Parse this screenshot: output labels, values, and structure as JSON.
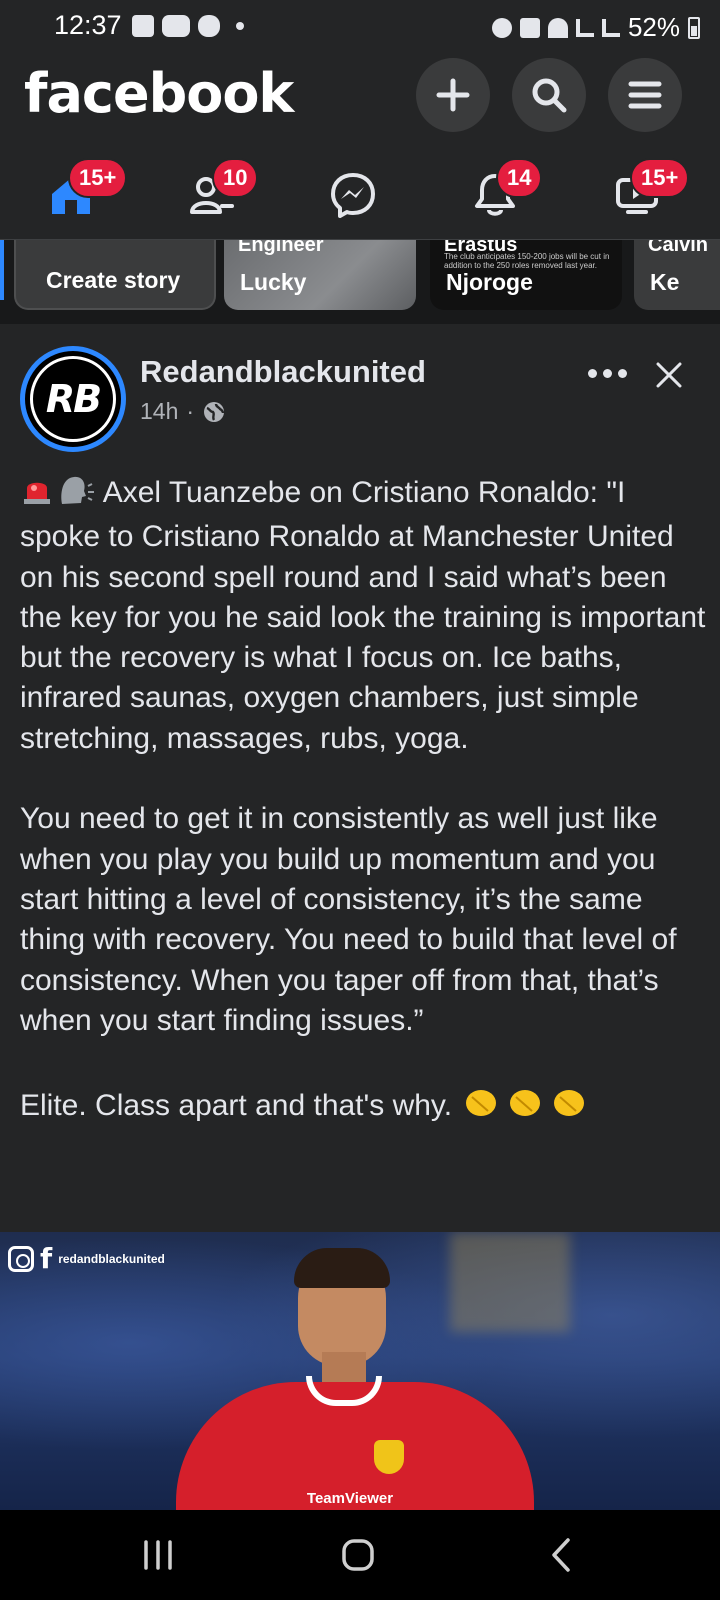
{
  "status_bar": {
    "time": "12:37",
    "battery": "52%"
  },
  "header": {
    "logo": "facebook",
    "buttons": [
      {
        "name": "create",
        "icon": "plus-icon"
      },
      {
        "name": "search",
        "icon": "search-icon"
      },
      {
        "name": "menu",
        "icon": "menu-icon"
      }
    ]
  },
  "nav_tabs": [
    {
      "name": "home",
      "icon": "home-icon",
      "badge": "15+"
    },
    {
      "name": "friends",
      "icon": "friends-icon",
      "badge": "10"
    },
    {
      "name": "messenger",
      "icon": "messenger-icon",
      "badge": ""
    },
    {
      "name": "notifications",
      "icon": "bell-icon",
      "badge": "14"
    },
    {
      "name": "video",
      "icon": "video-icon",
      "badge": "15+"
    }
  ],
  "stories": {
    "create_label": "Create story",
    "items": [
      {
        "top_text": "Engineer",
        "label": "Lucky"
      },
      {
        "top_text": "Erastus",
        "small_text": "The club anticipates 150-200 jobs will be cut in addition to the 250 roles removed last year.",
        "label": "Njoroge"
      },
      {
        "top_text": "Calvin",
        "label": "Ke"
      }
    ]
  },
  "post": {
    "author": "Redandblackunited",
    "avatar_text": "RB",
    "time": "14h",
    "separator": "·",
    "text": "Axel Tuanzebe on Cristiano Ronaldo: \"I spoke to Cristiano Ronaldo at Manchester United on his second spell round and I said what’s been the key for you he said look the training is important but the recovery is what I focus on. Ice baths, infrared saunas, oxygen chambers, just simple stretching, massages, rubs, yoga.\n\nYou need to get it in consistently as well just like when you play you build up momentum and you start hitting a level of consistency, it’s the same thing with recovery. You need to build that level of consistency. When you taper off from that, that’s when you start finding issues.”\n\nElite. Class apart and that's why. ",
    "image": {
      "watermark_f": "f",
      "watermark_handle": "redandblackunited",
      "sponsor_text": "TeamViewer"
    }
  },
  "colors": {
    "background": "#242526",
    "text": "#e4e6eb",
    "secondary_text": "#b0b3b8",
    "badge": "#e41e3f",
    "brand_blue": "#2d88ff",
    "feed_bg": "#18191a"
  }
}
